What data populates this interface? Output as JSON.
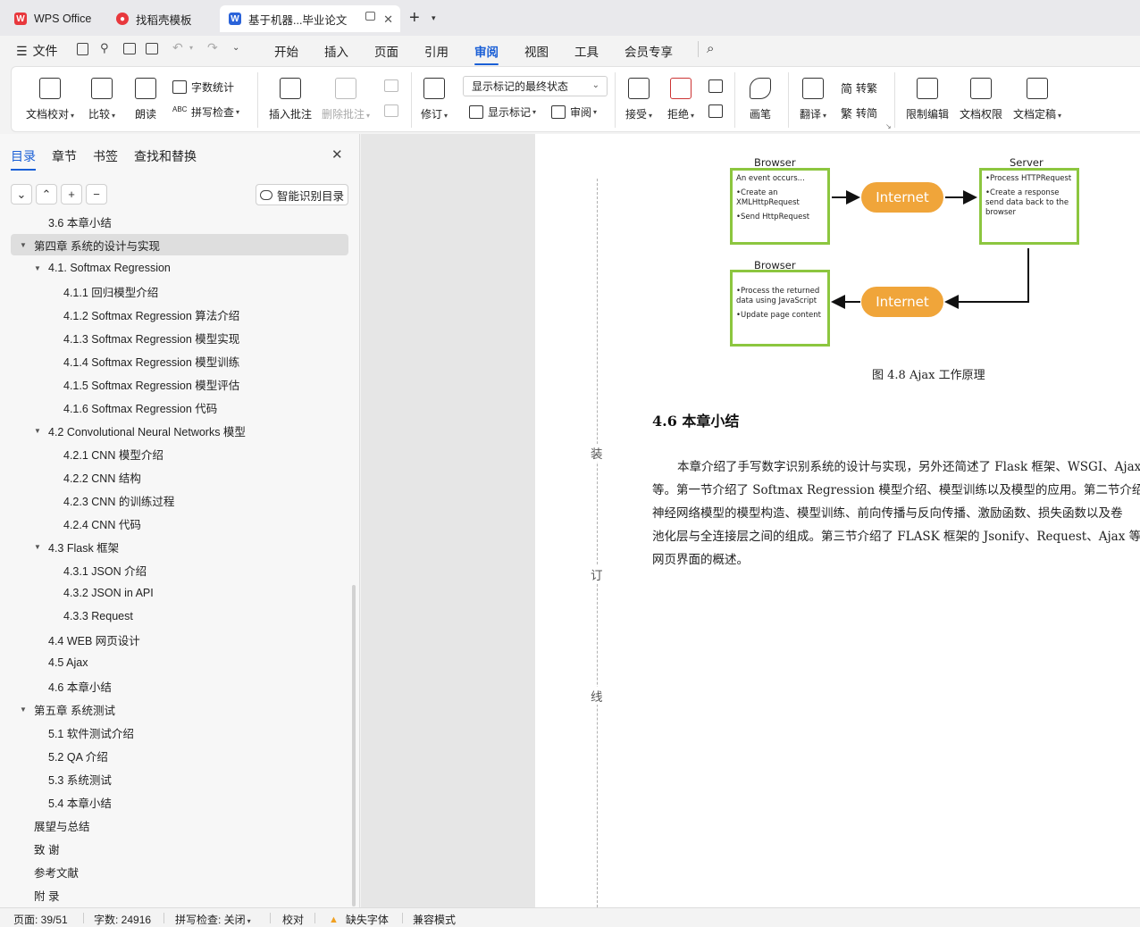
{
  "tabs": [
    {
      "label": "WPS Office",
      "icon": "wps-logo-icon"
    },
    {
      "label": "找稻壳模板",
      "icon": "docer-icon"
    },
    {
      "label": "基于机器...毕业论文",
      "icon": "writer-doc-icon"
    }
  ],
  "menu": {
    "file": "文件",
    "items": [
      "开始",
      "插入",
      "页面",
      "引用",
      "审阅",
      "视图",
      "工具",
      "会员专享"
    ],
    "active": "审阅"
  },
  "ribbon": {
    "doc_proofread": "文档校对",
    "compare": "比较",
    "read_aloud": "朗读",
    "word_count": "字数统计",
    "spell_check": "拼写检查",
    "insert_comment": "插入批注",
    "delete_comment": "删除批注",
    "revise": "修订",
    "markup_state": "显示标记的最终状态",
    "show_markup": "显示标记",
    "review": "审阅",
    "accept": "接受",
    "reject": "拒绝",
    "pen": "画笔",
    "translate": "翻译",
    "to_traditional": "转繁",
    "to_simplified": "转简",
    "restrict_edit": "限制编辑",
    "doc_permission": "文档权限",
    "doc_finalize": "文档定稿"
  },
  "nav": {
    "tabs": [
      "目录",
      "章节",
      "书签",
      "查找和替换"
    ],
    "smart_toc": "智能识别目录",
    "toc": [
      {
        "label": "3.6  本章小结",
        "level": 2
      },
      {
        "label": "第四章  系统的设计与实现",
        "level": 1,
        "expanded": true,
        "selected": true
      },
      {
        "label": "4.1. Softmax Regression",
        "level": 2,
        "expanded": true
      },
      {
        "label": "4.1.1 回归模型介绍",
        "level": 3
      },
      {
        "label": "4.1.2 Softmax Regression 算法介绍",
        "level": 3
      },
      {
        "label": "4.1.3 Softmax Regression 模型实现",
        "level": 3
      },
      {
        "label": "4.1.4 Softmax Regression 模型训练",
        "level": 3
      },
      {
        "label": "4.1.5 Softmax Regression 模型评估",
        "level": 3
      },
      {
        "label": "4.1.6    Softmax Regression 代码",
        "level": 3
      },
      {
        "label": "4.2 Convolutional Neural Networks 模型",
        "level": 2,
        "expanded": true
      },
      {
        "label": "4.2.1 CNN 模型介绍",
        "level": 3
      },
      {
        "label": "4.2.2 CNN 结构",
        "level": 3
      },
      {
        "label": "4.2.3 CNN 的训练过程",
        "level": 3
      },
      {
        "label": "4.2.4 CNN 代码",
        "level": 3
      },
      {
        "label": "4.3 Flask 框架",
        "level": 2,
        "expanded": true
      },
      {
        "label": "4.3.1 JSON 介绍",
        "level": 3
      },
      {
        "label": "4.3.2 JSON in API",
        "level": 3
      },
      {
        "label": "4.3.3 Request",
        "level": 3
      },
      {
        "label": "4.4 WEB 网页设计",
        "level": 2
      },
      {
        "label": "4.5 Ajax",
        "level": 2
      },
      {
        "label": "4.6  本章小结",
        "level": 2
      },
      {
        "label": "第五章  系统测试",
        "level": 1,
        "expanded": true
      },
      {
        "label": "5.1 软件测试介绍",
        "level": 2
      },
      {
        "label": "5.2 QA 介绍",
        "level": 2
      },
      {
        "label": "5.3  系统测试",
        "level": 2
      },
      {
        "label": "5.4 本章小结",
        "level": 2
      },
      {
        "label": "展望与总结",
        "level": 1
      },
      {
        "label": "致  谢",
        "level": 1
      },
      {
        "label": "参考文献",
        "level": 1
      },
      {
        "label": "附  录",
        "level": 1
      }
    ]
  },
  "doc": {
    "gutter": [
      "装",
      "订",
      "线"
    ],
    "diagram": {
      "browser_top_label": "Browser",
      "browser_top_lines": [
        "An event occurs...",
        "",
        "•Create an",
        "XMLHttpRequest object",
        "",
        "•Send HttpRequest"
      ],
      "server_label": "Server",
      "server_lines": [
        "•Process HTTPRequest",
        "",
        "•Create a response and",
        "send data back to the",
        "browser"
      ],
      "browser_bottom_label": "Browser",
      "browser_bottom_lines": [
        "•Process the returned",
        "data using JavaScript",
        "",
        "•Update page content"
      ],
      "internet_top": "Internet",
      "internet_bottom": "Internet",
      "pill_color": "#f0a53a",
      "box_border_color": "#8cc63f"
    },
    "caption": "图 4.8 Ajax 工作原理",
    "heading": "4.6  本章小结",
    "paragraph_lines": [
      "本章介绍了手写数字识别系统的设计与实现，另外还简述了 Flask 框架、WSGI、Ajax、",
      "等。第一节介绍了 Softmax Regression 模型介绍、模型训练以及模型的应用。第二节介绍了",
      "神经网络模型的模型构造、模型训练、前向传播与反向传播、激励函数、损失函数以及卷",
      "池化层与全连接层之间的组成。第三节介绍了 FLASK 框架的 Jsonify、Request、Ajax 等技",
      "网页界面的概述。"
    ]
  },
  "status": {
    "page": "页面: 39/51",
    "words": "字数: 24916",
    "spell": "拼写检查: 关闭",
    "proof": "校对",
    "missing_font": "缺失字体",
    "compat": "兼容模式"
  },
  "colors": {
    "accent": "#1a5fd6",
    "wps_red": "#e8383d",
    "warning": "#f0a020"
  }
}
